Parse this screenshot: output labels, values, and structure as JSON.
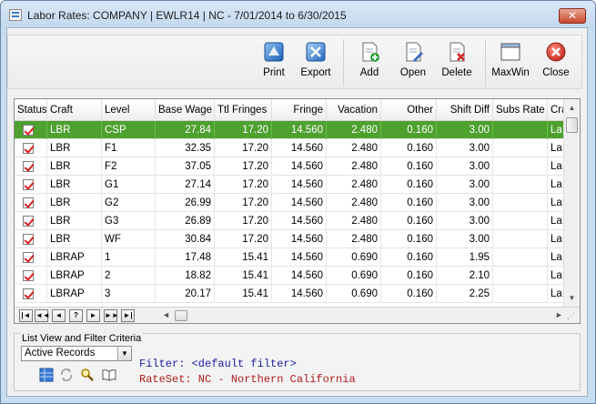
{
  "window": {
    "title": "Labor Rates: COMPANY | EWLR14 | NC -  7/01/2014 to  6/30/2015",
    "close_glyph": "✕"
  },
  "toolbar": {
    "buttons": [
      {
        "key": "print",
        "label": "Print",
        "icon": "print-icon"
      },
      {
        "key": "export",
        "label": "Export",
        "icon": "export-icon"
      },
      {
        "key": "add",
        "label": "Add",
        "icon": "add-document-icon"
      },
      {
        "key": "open",
        "label": "Open",
        "icon": "open-document-icon"
      },
      {
        "key": "delete",
        "label": "Delete",
        "icon": "delete-document-icon"
      },
      {
        "key": "maxwin",
        "label": "MaxWin",
        "icon": "maximize-window-icon"
      },
      {
        "key": "close",
        "label": "Close",
        "icon": "close-circle-icon"
      }
    ]
  },
  "grid": {
    "columns": [
      "Status",
      "Craft",
      "Level",
      "Base Wage",
      "Ttl Fringes",
      "Fringe",
      "Vacation",
      "Other",
      "Shift Diff",
      "Subs Rate",
      "Cra"
    ],
    "rows": [
      {
        "craft": "LBR",
        "level": "CSP",
        "base_wage": "27.84",
        "ttl_fringes": "17.20",
        "fringe": "14.560",
        "vacation": "2.480",
        "other": "0.160",
        "shift_diff": "3.00",
        "subs_rate": "",
        "cra": "La",
        "selected": true
      },
      {
        "craft": "LBR",
        "level": "F1",
        "base_wage": "32.35",
        "ttl_fringes": "17.20",
        "fringe": "14.560",
        "vacation": "2.480",
        "other": "0.160",
        "shift_diff": "3.00",
        "subs_rate": "",
        "cra": "La",
        "selected": false
      },
      {
        "craft": "LBR",
        "level": "F2",
        "base_wage": "37.05",
        "ttl_fringes": "17.20",
        "fringe": "14.560",
        "vacation": "2.480",
        "other": "0.160",
        "shift_diff": "3.00",
        "subs_rate": "",
        "cra": "La",
        "selected": false
      },
      {
        "craft": "LBR",
        "level": "G1",
        "base_wage": "27.14",
        "ttl_fringes": "17.20",
        "fringe": "14.560",
        "vacation": "2.480",
        "other": "0.160",
        "shift_diff": "3.00",
        "subs_rate": "",
        "cra": "La",
        "selected": false
      },
      {
        "craft": "LBR",
        "level": "G2",
        "base_wage": "26.99",
        "ttl_fringes": "17.20",
        "fringe": "14.560",
        "vacation": "2.480",
        "other": "0.160",
        "shift_diff": "3.00",
        "subs_rate": "",
        "cra": "La",
        "selected": false
      },
      {
        "craft": "LBR",
        "level": "G3",
        "base_wage": "26.89",
        "ttl_fringes": "17.20",
        "fringe": "14.560",
        "vacation": "2.480",
        "other": "0.160",
        "shift_diff": "3.00",
        "subs_rate": "",
        "cra": "La",
        "selected": false
      },
      {
        "craft": "LBR",
        "level": "WF",
        "base_wage": "30.84",
        "ttl_fringes": "17.20",
        "fringe": "14.560",
        "vacation": "2.480",
        "other": "0.160",
        "shift_diff": "3.00",
        "subs_rate": "",
        "cra": "La",
        "selected": false
      },
      {
        "craft": "LBRAP",
        "level": "1",
        "base_wage": "17.48",
        "ttl_fringes": "15.41",
        "fringe": "14.560",
        "vacation": "0.690",
        "other": "0.160",
        "shift_diff": "1.95",
        "subs_rate": "",
        "cra": "La",
        "selected": false
      },
      {
        "craft": "LBRAP",
        "level": "2",
        "base_wage": "18.82",
        "ttl_fringes": "15.41",
        "fringe": "14.560",
        "vacation": "0.690",
        "other": "0.160",
        "shift_diff": "2.10",
        "subs_rate": "",
        "cra": "La",
        "selected": false
      },
      {
        "craft": "LBRAP",
        "level": "3",
        "base_wage": "20.17",
        "ttl_fringes": "15.41",
        "fringe": "14.560",
        "vacation": "0.690",
        "other": "0.160",
        "shift_diff": "2.25",
        "subs_rate": "",
        "cra": "La",
        "selected": false
      }
    ],
    "nav_buttons": [
      "|◄",
      "◄◄",
      "◄",
      "?",
      "►",
      "►►",
      "►|"
    ],
    "selection_color": "#4ea12f",
    "check_color": "#d42020"
  },
  "filter": {
    "caption": "List View and Filter Criteria",
    "selected_view": "Active Records",
    "filter_text": "Filter: <default filter>",
    "rateset_text": "RateSet: NC - Northern California",
    "filter_color": "#1a1aa8",
    "rateset_color": "#b01a1a",
    "icons": [
      "grid-view-icon",
      "refresh-icon",
      "search-magnifier-icon",
      "book-icon"
    ]
  }
}
